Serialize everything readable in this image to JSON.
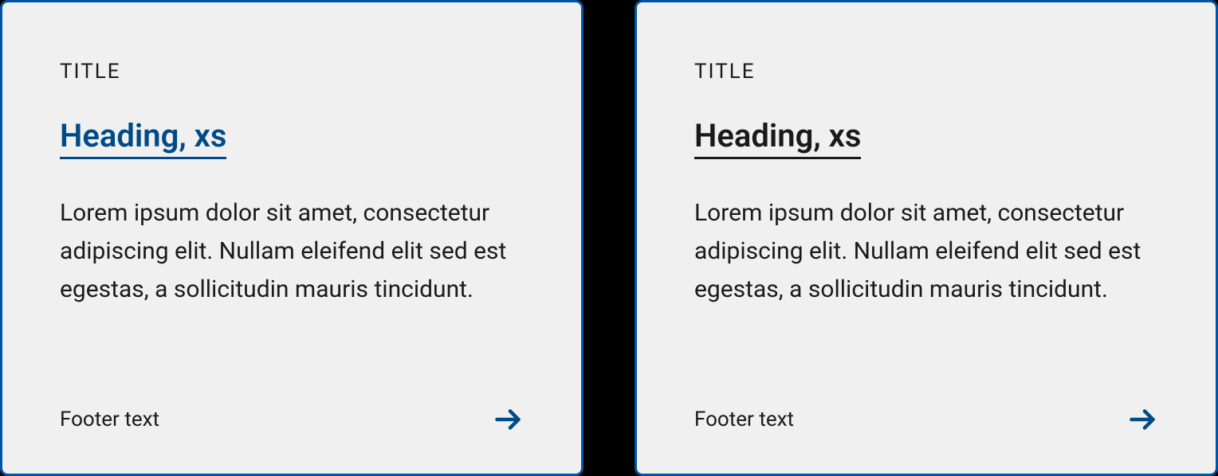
{
  "cards": [
    {
      "title": "TITLE",
      "heading": "Heading, xs",
      "body": "Lorem ipsum dolor sit amet, consectetur adipiscing elit. Nullam eleifend elit sed est egestas, a sollicitudin mauris tincidunt.",
      "footer": "Footer text"
    },
    {
      "title": "TITLE",
      "heading": "Heading, xs",
      "body": "Lorem ipsum dolor sit amet, consectetur adipiscing elit. Nullam eleifend elit sed est egestas, a sollicitudin mauris tincidunt.",
      "footer": "Footer text"
    }
  ],
  "colors": {
    "accent": "#004b87",
    "border": "#0054a6",
    "text": "#1a1a1a",
    "bg": "#f0f0f0"
  }
}
